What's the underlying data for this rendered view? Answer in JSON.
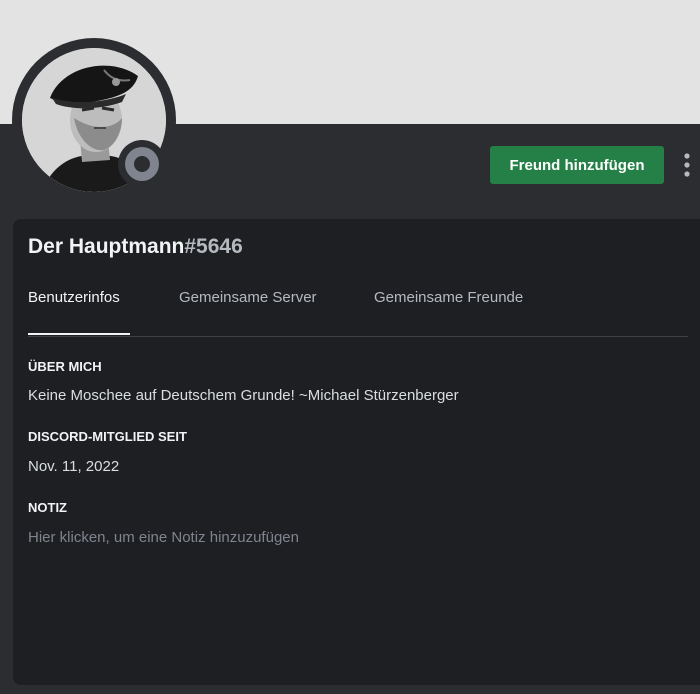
{
  "profile": {
    "username": "Der Hauptmann",
    "discriminator": "#5646",
    "status": "offline-icon"
  },
  "actions": {
    "add_friend_label": "Freund hinzufügen",
    "more_icon": "more-vertical-icon"
  },
  "tabs": [
    {
      "label": "Benutzerinfos"
    },
    {
      "label": "Gemeinsame Server"
    },
    {
      "label": "Gemeinsame Freunde"
    }
  ],
  "about": {
    "title": "ÜBER MICH",
    "text": "Keine Moschee auf Deutschem Grunde! ~Michael Stürzenberger"
  },
  "member_since": {
    "title": "DISCORD-MITGLIED SEIT",
    "date": "Nov. 11, 2022"
  },
  "note": {
    "title": "NOTIZ",
    "placeholder": "Hier klicken, um eine Notiz hinzuzufügen"
  },
  "colors": {
    "banner": "#e3e3e3",
    "accent_button": "#248046",
    "background": "#2b2d31",
    "card": "#1e1f22"
  }
}
